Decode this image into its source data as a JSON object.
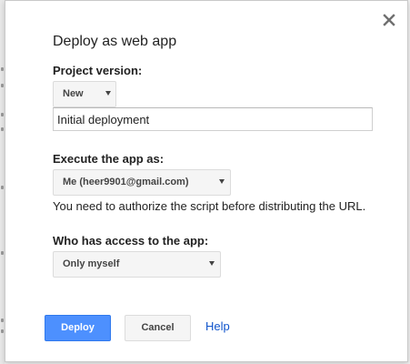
{
  "dialog": {
    "title": "Deploy as web app",
    "close_icon": "close-icon"
  },
  "project_version": {
    "label": "Project version:",
    "selected": "New",
    "description_value": "Initial deployment"
  },
  "execute_as": {
    "label": "Execute the app as:",
    "selected": "Me (heer9901@gmail.com)",
    "note": "You need to authorize the script before distributing the URL."
  },
  "access": {
    "label": "Who has access to the app:",
    "selected": "Only myself"
  },
  "actions": {
    "deploy_label": "Deploy",
    "cancel_label": "Cancel",
    "help_label": "Help"
  },
  "colors": {
    "primary_button": "#4d90fe",
    "link": "#1155cc"
  }
}
